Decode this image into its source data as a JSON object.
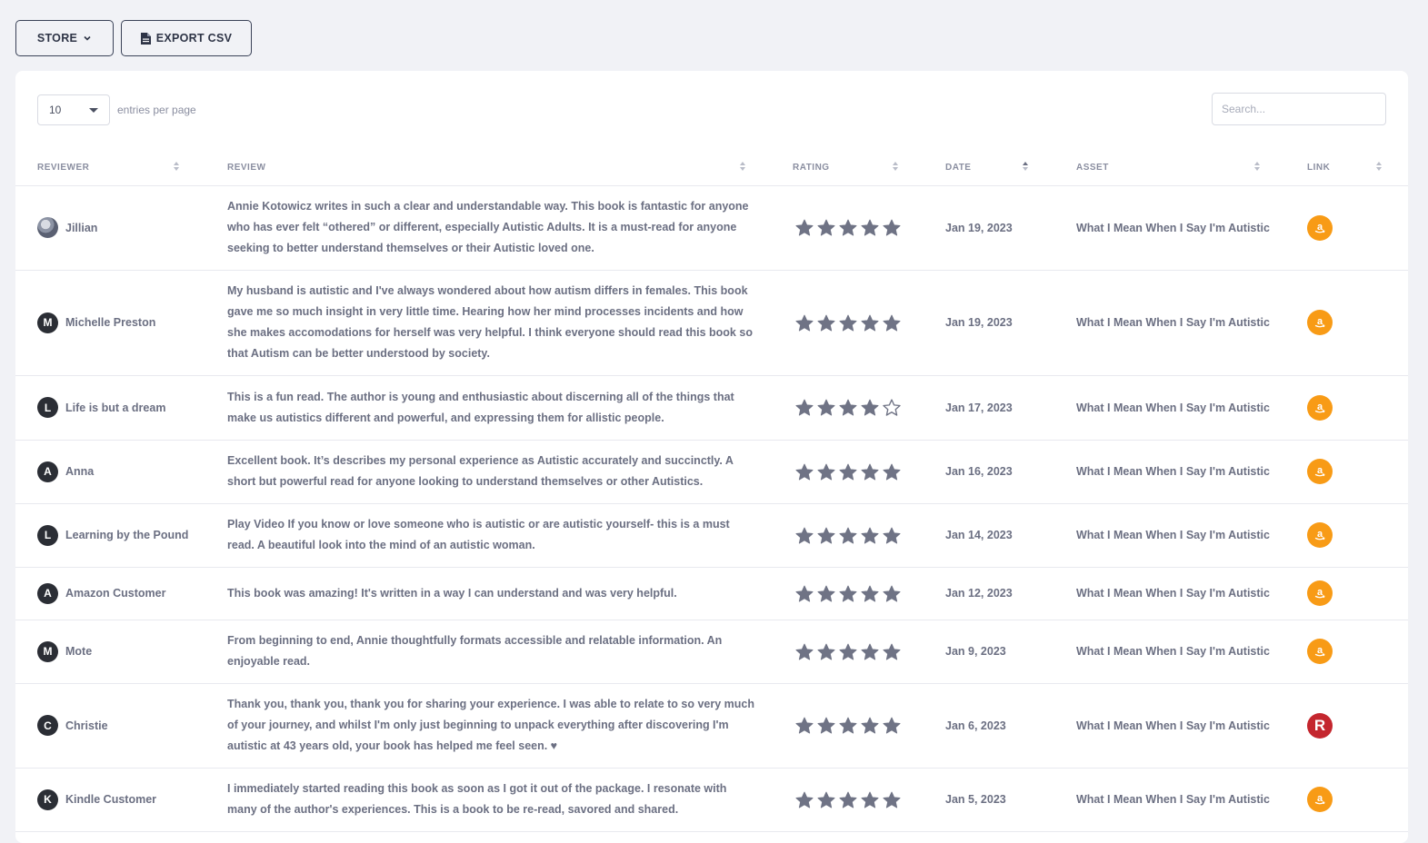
{
  "toolbar": {
    "store_label": "STORE",
    "export_label": "EXPORT CSV"
  },
  "table_controls": {
    "entries_value": "10",
    "entries_label": "entries per page",
    "search_placeholder": "Search..."
  },
  "columns": [
    "REVIEWER",
    "REVIEW",
    "RATING",
    "DATE",
    "ASSET",
    "LINK"
  ],
  "colors": {
    "amazon": "#f89b16",
    "rakuten": "#c4262e",
    "star": "#6f7385",
    "avatar": "#2b2e35"
  },
  "rows": [
    {
      "initial": "",
      "avatar_icon": "photo-avatar",
      "name": "Jillian",
      "review": "Annie Kotowicz writes in such a clear and understandable way. This book is fantastic for anyone who has ever felt “othered” or different, especially Autistic Adults. It is a must-read for anyone seeking to better understand themselves or their Autistic loved one.",
      "rating": 5,
      "date": "Jan 19, 2023",
      "asset": "What I Mean When I Say I'm Autistic",
      "link_icon": "amazon-icon"
    },
    {
      "initial": "M",
      "name": "Michelle Preston",
      "review": "My husband is autistic and I've always wondered about how autism differs in females. This book gave me so much insight in very little time. Hearing how her mind processes incidents and how she makes accomodations for herself was very helpful. I think everyone should read this book so that Autism can be better understood by society.",
      "rating": 5,
      "date": "Jan 19, 2023",
      "asset": "What I Mean When I Say I'm Autistic",
      "link_icon": "amazon-icon"
    },
    {
      "initial": "L",
      "name": "Life is but a dream",
      "review": "This is a fun read. The author is young and enthusiastic about discerning all of the things that make us autistics different and powerful, and expressing them for allistic people.",
      "rating": 4,
      "date": "Jan 17, 2023",
      "asset": "What I Mean When I Say I'm Autistic",
      "link_icon": "amazon-icon"
    },
    {
      "initial": "A",
      "name": "Anna",
      "review": "Excellent book. It’s describes my personal experience as Autistic accurately and succinctly. A short but powerful read for anyone looking to understand themselves or other Autistics.",
      "rating": 5,
      "date": "Jan 16, 2023",
      "asset": "What I Mean When I Say I'm Autistic",
      "link_icon": "amazon-icon"
    },
    {
      "initial": "L",
      "name": "Learning by the Pound",
      "review": "Play Video If you know or love someone who is autistic or are autistic yourself- this is a must read. A beautiful look into the mind of an autistic woman.",
      "rating": 5,
      "date": "Jan 14, 2023",
      "asset": "What I Mean When I Say I'm Autistic",
      "link_icon": "amazon-icon"
    },
    {
      "initial": "A",
      "name": "Amazon Customer",
      "review": "This book was amazing! It's written in a way I can understand and was very helpful.",
      "rating": 5,
      "date": "Jan 12, 2023",
      "asset": "What I Mean When I Say I'm Autistic",
      "link_icon": "amazon-icon"
    },
    {
      "initial": "M",
      "name": "Mote",
      "review": "From beginning to end, Annie thoughtfully formats accessible and relatable information. An enjoyable read.",
      "rating": 5,
      "date": "Jan 9, 2023",
      "asset": "What I Mean When I Say I'm Autistic",
      "link_icon": "amazon-icon"
    },
    {
      "initial": "C",
      "name": "Christie",
      "review": "Thank you, thank you, thank you for sharing your experience. I was able to relate to so very much of your journey, and whilst I'm only just beginning to unpack everything after discovering I'm autistic at 43 years old, your book has helped me feel seen. ♥",
      "rating": 5,
      "date": "Jan 6, 2023",
      "asset": "What I Mean When I Say I'm Autistic",
      "link_icon": "rakuten-icon",
      "link_letter": "R"
    },
    {
      "initial": "K",
      "name": "Kindle Customer",
      "review": "I immediately started reading this book as soon as I got it out of the package. I resonate with many of the author's experiences. This is a book to be re-read, savored and shared.",
      "rating": 5,
      "date": "Jan 5, 2023",
      "asset": "What I Mean When I Say I'm Autistic",
      "link_icon": "amazon-icon"
    }
  ]
}
